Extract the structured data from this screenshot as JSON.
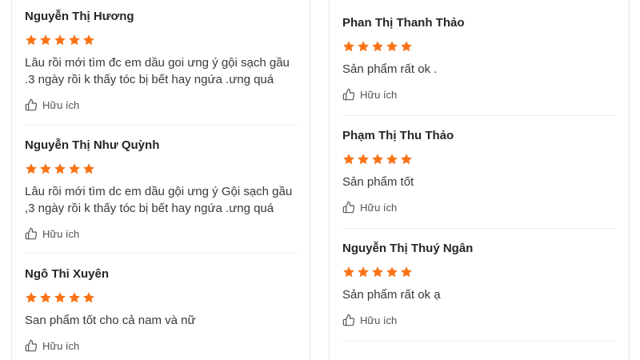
{
  "colors": {
    "star": "#f97316",
    "name": "#27272a",
    "divider": "#ebebf0"
  },
  "icons": {
    "rating": "star-icon",
    "helpful": "thumbs-up-icon"
  },
  "left_reviews": [
    {
      "name": "Nguyễn Thị Hương",
      "rating": 5,
      "comment": "Lâu rồi mới tìm đc em dầu goi ưng ý gội sạch gầu .3 ngày rồi k thấy tóc bị bết hay ngứa .ưng quá",
      "helpful": "Hữu ích"
    },
    {
      "name": "Nguyễn Thị Như Quỳnh",
      "rating": 5,
      "comment": "Lâu rồi mới tìm dc em dầu gội ưng ý Gội sạch gầu ,3 ngày rồi k thấy tóc bị bết hay ngứa .ưng quá",
      "helpful": "Hữu ích"
    },
    {
      "name": "Ngô Thi Xuyên",
      "rating": 5,
      "comment": "San phẩm tốt cho cả nam và nữ",
      "helpful": "Hữu ích"
    }
  ],
  "right_reviews": [
    {
      "name": "Phan Thị Thanh Thảo",
      "rating": 5,
      "comment": "Sản phẩm rất ok .",
      "helpful": "Hữu ích"
    },
    {
      "name": "Phạm Thị Thu Thảo",
      "rating": 5,
      "comment": "Sản phẩm tốt",
      "helpful": "Hữu ích"
    },
    {
      "name": "Nguyễn Thị Thuý Ngân",
      "rating": 5,
      "comment": "Sản phẩm rất ok ạ",
      "helpful": "Hữu ích"
    }
  ]
}
